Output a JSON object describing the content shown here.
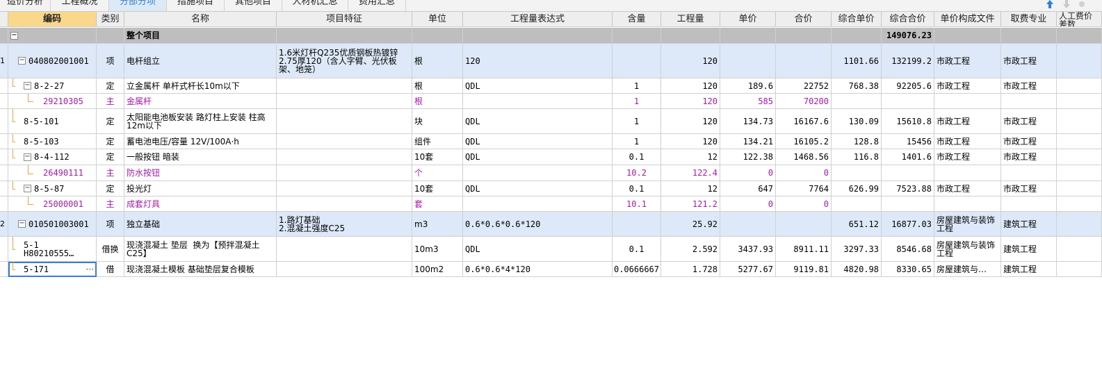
{
  "tabs": [
    {
      "label": "造价分析",
      "active": false
    },
    {
      "label": "工程概况",
      "active": false
    },
    {
      "label": "分部分项",
      "active": true
    },
    {
      "label": "措施项目",
      "active": false
    },
    {
      "label": "其他项目",
      "active": false
    },
    {
      "label": "人材机汇总",
      "active": false
    },
    {
      "label": "费用汇总",
      "active": false
    }
  ],
  "toolbar": {
    "up_icon": "arrow-up-icon",
    "down_icon": "arrow-down-icon"
  },
  "columns": [
    "编码",
    "类别",
    "名称",
    "项目特征",
    "单位",
    "工程量表达式",
    "含量",
    "工程量",
    "单价",
    "合价",
    "综合单价",
    "综合合价",
    "单价构成文件",
    "取费专业",
    "人工费价差数"
  ],
  "total_row": {
    "label": "整个项目",
    "toggle": "−",
    "total": "149076.23"
  },
  "rows": [
    {
      "num": "1",
      "toggle": "−",
      "code": "040802001001",
      "type": "项",
      "name": "电杆组立",
      "feature": "1.6米灯杆Q235优质钢板热镀锌\n2.75厚120（含人字臂、光伏板架、地笼）",
      "unit": "根",
      "expr": "120",
      "qty_ratio": "",
      "qty": "120",
      "price": "",
      "amount": "",
      "unit_total": "1101.66",
      "total": "132199.2",
      "file": "市政工程",
      "profession": "市政工程"
    },
    {
      "num": "",
      "toggle": "−",
      "code": "8-2-27",
      "type": "定",
      "name": "立金属杆 单杆式杆长10m以下",
      "feature": "",
      "unit": "根",
      "expr": "QDL",
      "qty_ratio": "1",
      "qty": "120",
      "price": "189.6",
      "amount": "22752",
      "unit_total": "768.38",
      "total": "92205.6",
      "file": "市政工程",
      "profession": "市政工程"
    },
    {
      "num": "",
      "toggle": "",
      "code": "29210305",
      "type": "主",
      "name": "金属杆",
      "feature": "",
      "unit": "根",
      "expr": "",
      "qty_ratio": "1",
      "qty": "120",
      "price": "585",
      "amount": "70200",
      "unit_total": "",
      "total": "",
      "file": "",
      "profession": ""
    },
    {
      "num": "",
      "toggle": "",
      "code": "8-5-101",
      "type": "定",
      "name": "太阳能电池板安装 路灯柱上安装 柱高12m以下",
      "feature": "",
      "unit": "块",
      "expr": "QDL",
      "qty_ratio": "1",
      "qty": "120",
      "price": "134.73",
      "amount": "16167.6",
      "unit_total": "130.09",
      "total": "15610.8",
      "file": "市政工程",
      "profession": "市政工程"
    },
    {
      "num": "",
      "toggle": "",
      "code": "8-5-103",
      "type": "定",
      "name": "蓄电池电压/容量 12V/100A·h",
      "feature": "",
      "unit": "组件",
      "expr": "QDL",
      "qty_ratio": "1",
      "qty": "120",
      "price": "134.21",
      "amount": "16105.2",
      "unit_total": "128.8",
      "total": "15456",
      "file": "市政工程",
      "profession": "市政工程"
    },
    {
      "num": "",
      "toggle": "−",
      "code": "8-4-112",
      "type": "定",
      "name": "一般按钮 暗装",
      "feature": "",
      "unit": "10套",
      "expr": "QDL",
      "qty_ratio": "0.1",
      "qty": "12",
      "price": "122.38",
      "amount": "1468.56",
      "unit_total": "116.8",
      "total": "1401.6",
      "file": "市政工程",
      "profession": "市政工程"
    },
    {
      "num": "",
      "toggle": "",
      "code": "26490111",
      "type": "主",
      "name": "防水按钮",
      "feature": "",
      "unit": "个",
      "expr": "",
      "qty_ratio": "10.2",
      "qty": "122.4",
      "price": "0",
      "amount": "0",
      "unit_total": "",
      "total": "",
      "file": "",
      "profession": ""
    },
    {
      "num": "",
      "toggle": "−",
      "code": "8-5-87",
      "type": "定",
      "name": "投光灯",
      "feature": "",
      "unit": "10套",
      "expr": "QDL",
      "qty_ratio": "0.1",
      "qty": "12",
      "price": "647",
      "amount": "7764",
      "unit_total": "626.99",
      "total": "7523.88",
      "file": "市政工程",
      "profession": "市政工程"
    },
    {
      "num": "",
      "toggle": "",
      "code": "25000001",
      "type": "主",
      "name": "成套灯具",
      "feature": "",
      "unit": "套",
      "expr": "",
      "qty_ratio": "10.1",
      "qty": "121.2",
      "price": "0",
      "amount": "0",
      "unit_total": "",
      "total": "",
      "file": "",
      "profession": ""
    },
    {
      "num": "2",
      "toggle": "−",
      "code": "010501003001",
      "type": "项",
      "name": "独立基础",
      "feature": "1.路灯基础\n2.混凝土强度C25",
      "unit": "m3",
      "expr": "0.6*0.6*0.6*120",
      "qty_ratio": "",
      "qty": "25.92",
      "price": "",
      "amount": "",
      "unit_total": "651.12",
      "total": "16877.03",
      "file": "房屋建筑与装饰工程",
      "profession": "建筑工程"
    },
    {
      "num": "",
      "toggle": "",
      "code": "5-1\nH80210555…",
      "type": "借换",
      "name": "现浇混凝土 垫层  换为【预拌混凝土C25】",
      "feature": "",
      "unit": "10m3",
      "expr": "QDL",
      "qty_ratio": "0.1",
      "qty": "2.592",
      "price": "3437.93",
      "amount": "8911.11",
      "unit_total": "3297.33",
      "total": "8546.68",
      "file": "房屋建筑与装饰工程",
      "profession": "建筑工程"
    },
    {
      "num": "",
      "toggle": "",
      "code": "5-171",
      "type": "借",
      "name": "现浇混凝土模板 基础垫层复合模板",
      "feature": "",
      "unit": "100m2",
      "expr": "0.6*0.6*4*120",
      "qty_ratio": "0.0666667",
      "qty": "1.728",
      "price": "5277.67",
      "amount": "9119.81",
      "unit_total": "4820.98",
      "total": "8330.65",
      "file": "房屋建筑与…",
      "profession": "建筑工程",
      "ellipsis": "···"
    }
  ]
}
